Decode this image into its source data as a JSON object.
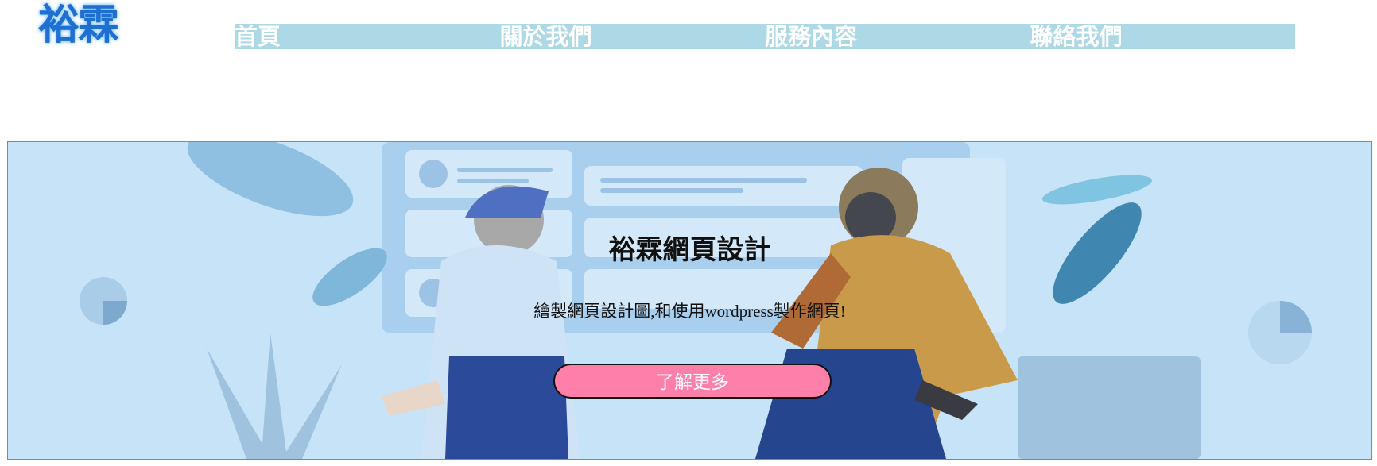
{
  "brand": {
    "logo_text": "裕霖"
  },
  "nav": {
    "items": [
      {
        "label": "首頁"
      },
      {
        "label": "關於我們"
      },
      {
        "label": "服務內容"
      },
      {
        "label": "聯絡我們"
      }
    ]
  },
  "hero": {
    "title": "裕霖網頁設計",
    "subtitle": "繪製網頁設計圖,和使用wordpress製作網頁!",
    "cta_label": "了解更多",
    "illustration": "two-people-handshake-illustration"
  },
  "colors": {
    "logo": "#1e6fd0",
    "nav_bg": "#add8e6",
    "nav_text": "#ffffff",
    "hero_bg": "#c7e3f7",
    "cta_bg": "#ff7fab"
  }
}
